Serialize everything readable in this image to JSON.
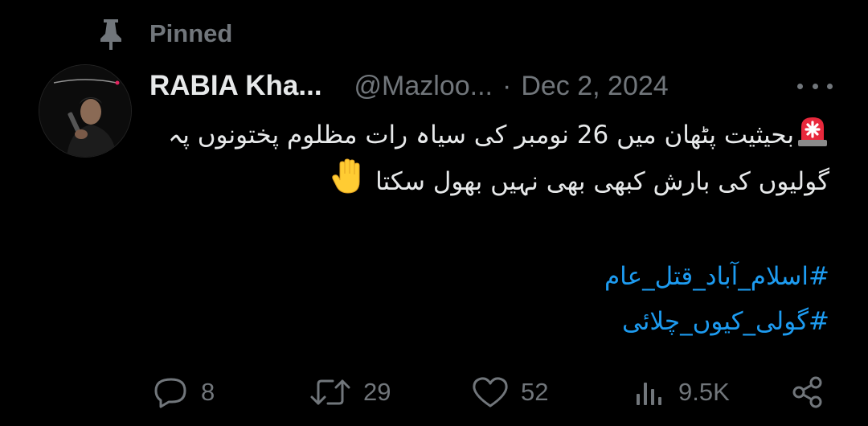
{
  "pinned": {
    "label": "Pinned",
    "icon": "pin-icon"
  },
  "author": {
    "display_name": "RABIA Kha...",
    "handle": "@Mazloo...",
    "separator": "·",
    "date": "Dec 2, 2024"
  },
  "tweet": {
    "text": "بحیثیت پٹھان میں 26 نومبر کی سیاہ رات مظلوم پختونوں پہ گولیوں کی بارش کبھی بھی نہیں بھول سکتا",
    "leading_emoji": "rotating-light-emoji",
    "trailing_emoji": "raised-hand-emoji",
    "hashtags": [
      "#اسلام_آباد_قتل_عام",
      "#گولی_کیوں_چلائی"
    ]
  },
  "actions": {
    "replies": "8",
    "reposts": "29",
    "likes": "52",
    "views": "9.5K"
  },
  "colors": {
    "background": "#000000",
    "text": "#e7e9ea",
    "muted": "#71767b",
    "link": "#1d9bf0"
  }
}
